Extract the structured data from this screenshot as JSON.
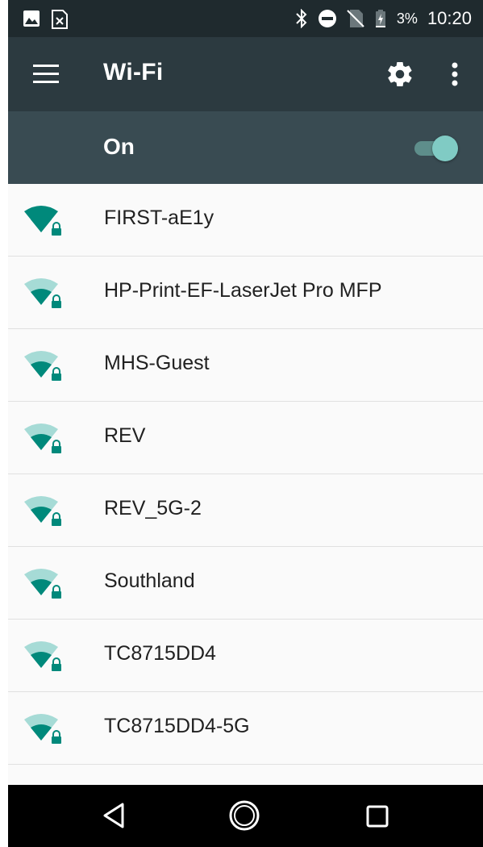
{
  "status_bar": {
    "battery": "3%",
    "time": "10:20",
    "icons": [
      "image-icon",
      "sim-missing-notice-icon",
      "bluetooth-icon",
      "do-not-disturb-icon",
      "no-sim-icon",
      "battery-charging-icon"
    ]
  },
  "toolbar": {
    "title": "Wi-Fi",
    "icons": [
      "menu-icon",
      "gear-icon",
      "more-vert-icon"
    ]
  },
  "wifi_switch": {
    "label": "On",
    "enabled": true
  },
  "networks": [
    {
      "ssid": "FIRST-aE1y",
      "signal_bars": 4,
      "secured": true
    },
    {
      "ssid": "HP-Print-EF-LaserJet Pro MFP",
      "signal_bars": 2,
      "secured": true
    },
    {
      "ssid": "MHS-Guest",
      "signal_bars": 2,
      "secured": true
    },
    {
      "ssid": "REV",
      "signal_bars": 2,
      "secured": true
    },
    {
      "ssid": "REV_5G-2",
      "signal_bars": 2,
      "secured": true
    },
    {
      "ssid": "Southland",
      "signal_bars": 2,
      "secured": true
    },
    {
      "ssid": "TC8715DD4",
      "signal_bars": 2,
      "secured": true
    },
    {
      "ssid": "TC8715DD4-5G",
      "signal_bars": 2,
      "secured": true
    }
  ],
  "nav_bar": {
    "icons": [
      "back-icon",
      "home-icon",
      "recents-icon"
    ]
  },
  "colors": {
    "status_bar": "#1f2a2e",
    "toolbar": "#2c3a40",
    "switch_bar": "#394b52",
    "accent": "#80cbc4",
    "wifi_icon": "#00897b"
  }
}
